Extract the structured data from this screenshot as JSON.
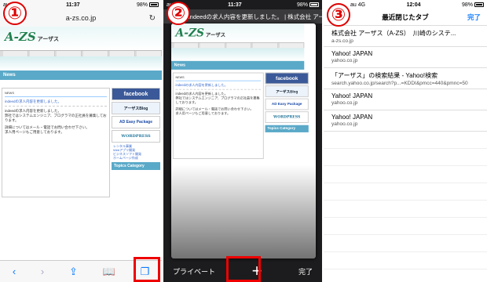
{
  "markers": [
    "①",
    "②",
    "③"
  ],
  "panel1": {
    "status": {
      "carrier": "au",
      "time": "11:37",
      "battery": "98%"
    },
    "url": "a-zs.co.jp",
    "reload_icon": "↻",
    "logo": "A-ZS",
    "logo_sub": "アーザス",
    "news_title": "News",
    "content_label": "NEWS",
    "news_heading": "indeedの求人内容を更新しました。",
    "news_lines": [
      "indeedの求人内容を更新しました。",
      "弊社ではシステムエンジニア、プログラマの正社員を募集しております。",
      "詳細についてはメール・電話でお問い合わせ下さい。",
      "求人用ページもご用意しております。"
    ],
    "ads": [
      "facebook",
      "アーザスBlog",
      "AD Easy Package",
      "WORDPRESS"
    ],
    "side_links": [
      "レンタル事業",
      "Webアプリ開発",
      "ビジネスソフト開発",
      "ホームページ作成"
    ],
    "topics_title": "Topics Category",
    "toolbar_icons": [
      "back-icon",
      "forward-icon",
      "share-icon",
      "bookmarks-icon",
      "tabs-icon"
    ]
  },
  "panel2": {
    "status": {
      "carrier": "au",
      "time": "11:37",
      "battery": "98%"
    },
    "tab_title": "indeedの求人内容を更新しました。 | 株式会社 アーザス（A-Z",
    "private_label": "プライベート",
    "plus_label": "+",
    "done_label": "完了"
  },
  "panel3": {
    "status": {
      "carrier": "au 4G",
      "time": "12:04",
      "battery": "98%"
    },
    "header_title": "最近閉じたタブ",
    "done_label": "完了",
    "items": [
      {
        "title": "株式会社 アーザス（A-ZS）　川崎のシステ...",
        "url": "a-zs.co.jp"
      },
      {
        "title": "Yahoo! JAPAN",
        "url": "yahoo.co.jp"
      },
      {
        "title": "「アーザス」の検索結果 - Yahoo!検索",
        "url": "search.yahoo.co.jp/search?p...=KDDI&pmcc=440&pmnc=50"
      },
      {
        "title": "Yahoo! JAPAN",
        "url": "yahoo.co.jp"
      },
      {
        "title": "Yahoo! JAPAN",
        "url": "yahoo.co.jp"
      }
    ]
  }
}
